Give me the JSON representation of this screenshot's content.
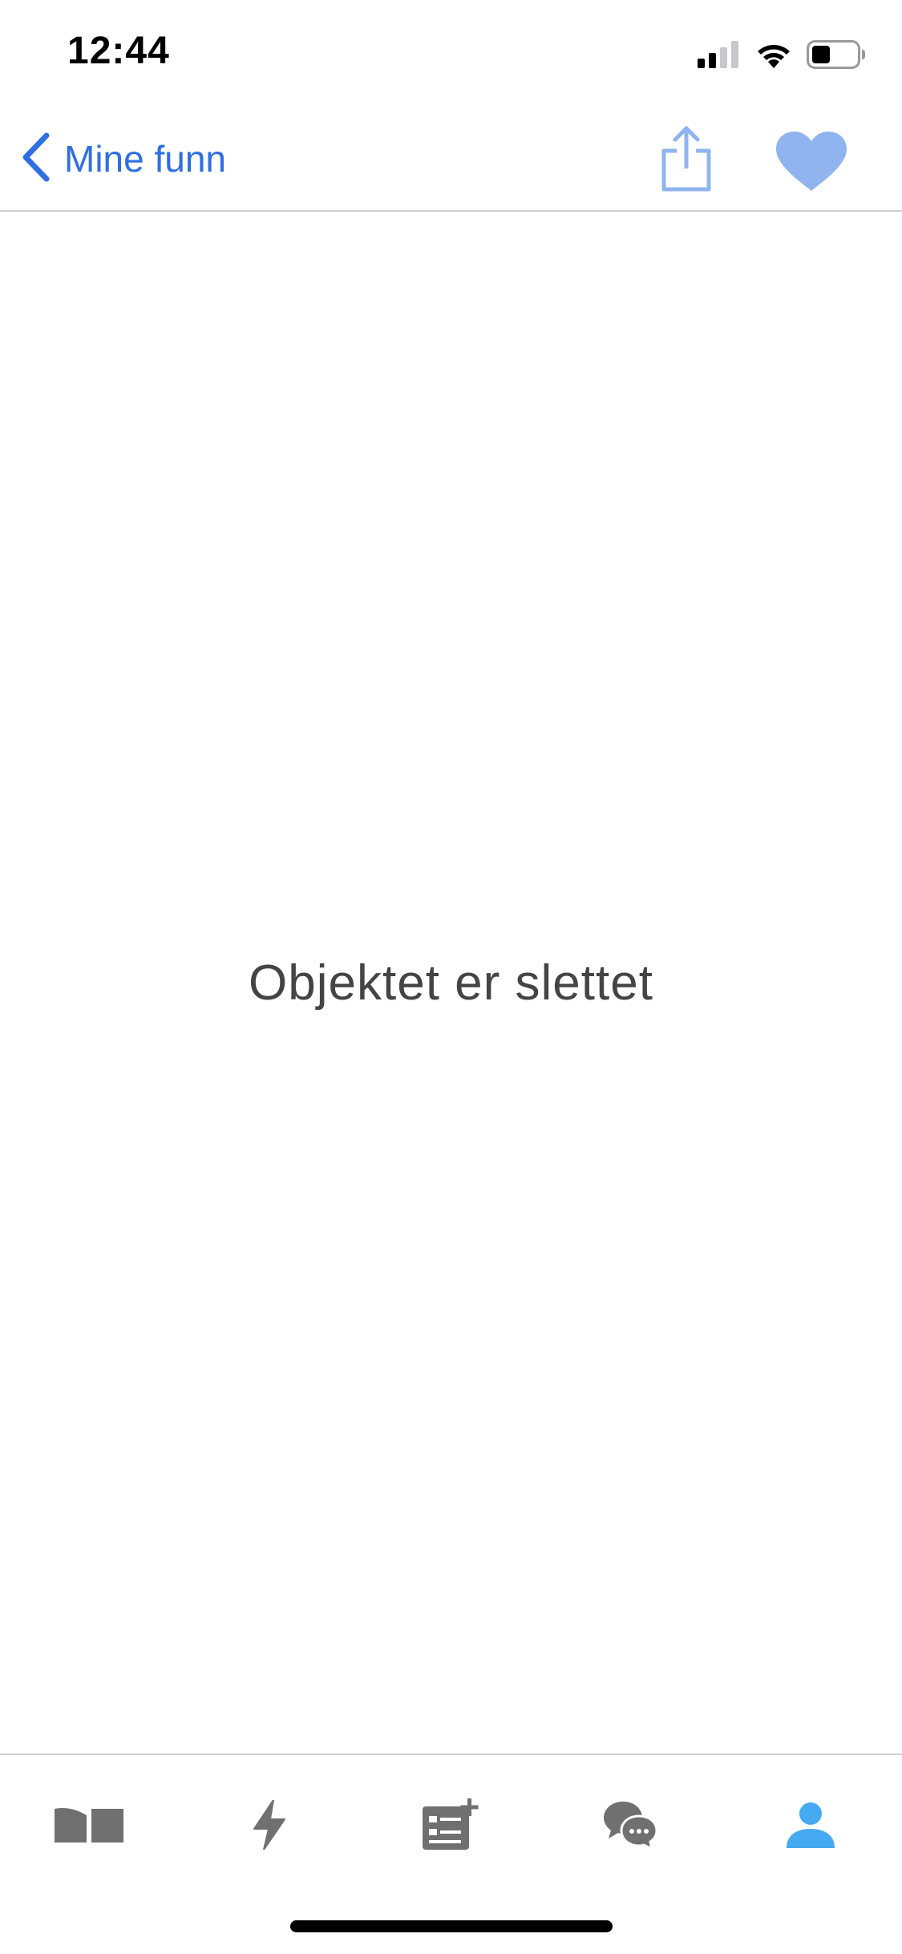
{
  "status_bar": {
    "time": "12:44",
    "icons": [
      "cellular-signal-icon",
      "wifi-icon",
      "battery-icon"
    ]
  },
  "nav": {
    "back_label": "Mine funn",
    "share_icon": "share-icon",
    "favorite_icon": "heart-icon"
  },
  "content": {
    "message": "Objektet er slettet"
  },
  "tab_bar": {
    "tabs": [
      {
        "icon": "browse-icon",
        "selected": false
      },
      {
        "icon": "lightning-icon",
        "selected": false
      },
      {
        "icon": "new-ad-icon",
        "selected": false
      },
      {
        "icon": "messages-icon",
        "selected": false
      },
      {
        "icon": "profile-icon",
        "selected": true
      }
    ]
  },
  "colors": {
    "accent": "#2f6fe4",
    "accent_light": "#8fb4f0",
    "tab_inactive": "#707070",
    "tab_active": "#45aaf2",
    "text": "#444444"
  }
}
